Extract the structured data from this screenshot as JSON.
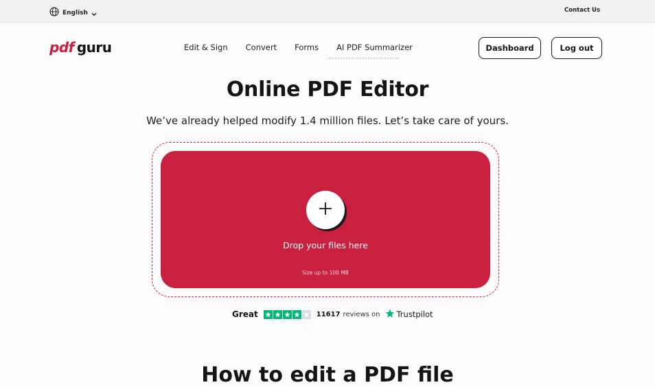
{
  "topbar": {
    "language": "English",
    "contact": "Contact Us"
  },
  "logo": {
    "pdf": "pdf",
    "guru": "guru"
  },
  "nav": {
    "items": [
      "Edit & Sign",
      "Convert",
      "Forms",
      "AI PDF Summarizer"
    ]
  },
  "header": {
    "dashboard": "Dashboard",
    "logout": "Log out"
  },
  "hero": {
    "title": "Online PDF Editor",
    "subtitle": "We’ve already helped modify 1.4 million files. Let’s take care of yours."
  },
  "dropzone": {
    "label": "Drop your files here",
    "size_note": "Size up to 100 MB"
  },
  "trustpilot": {
    "rating_word": "Great",
    "stars_filled": 4,
    "stars_total": 5,
    "review_count": "11617",
    "reviews_on": "reviews on",
    "brand": "Trustpilot"
  },
  "next_section": {
    "heading": "How to edit a PDF file"
  },
  "colors": {
    "brand_red": "#ca2040",
    "trustpilot_green": "#00b67a"
  },
  "icons": {
    "language": "globe-icon",
    "language_toggle": "chevron-down-icon",
    "upload": "plus-icon",
    "trustpilot": "star-icon"
  }
}
